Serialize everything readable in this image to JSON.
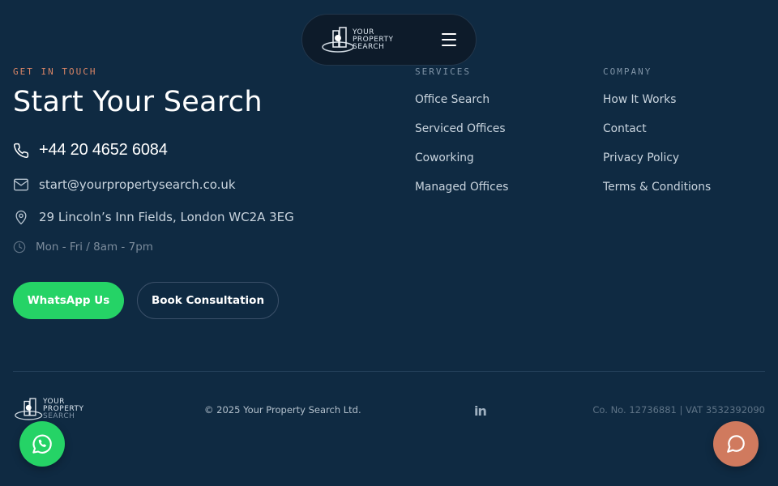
{
  "header": {
    "logo": {
      "line1": "YOUR",
      "line2": "PROPERTY",
      "line3": "SEARCH"
    },
    "menu_icon": "hamburger-icon"
  },
  "contact": {
    "eyebrow": "GET IN TOUCH",
    "title": "Start Your Search",
    "phone": "+44 20 4652 6084",
    "email": "start@yourpropertysearch.co.uk",
    "address": "29 Lincoln’s Inn Fields, London WC2A 3EG",
    "hours": "Mon - Fri / 8am - 7pm",
    "whatsapp_label": "WhatsApp Us",
    "book_label": "Book Consultation"
  },
  "services": {
    "heading": "SERVICES",
    "items": [
      "Office Search",
      "Serviced Offices",
      "Coworking",
      "Managed Offices"
    ]
  },
  "company": {
    "heading": "COMPANY",
    "items": [
      "How It Works",
      "Contact",
      "Privacy Policy",
      "Terms & Conditions"
    ]
  },
  "footer": {
    "logo": {
      "line1": "YOUR",
      "line2": "PROPERTY",
      "line3": "SEARCH"
    },
    "copyright": "© 2025 Your Property Search Ltd.",
    "linkedin": "in",
    "company_no": "Co. No. 12736881 | VAT 3532392090"
  },
  "colors": {
    "background": "#0f2a42",
    "accent_eyebrow": "#d98566",
    "whatsapp": "#25d366",
    "chat": "#d07a5e"
  },
  "icons": {
    "phone": "phone-icon",
    "email": "mail-icon",
    "address": "map-pin-icon",
    "hours": "clock-icon",
    "whatsapp_float": "whatsapp-icon",
    "chat_float": "chat-bubble-icon"
  }
}
